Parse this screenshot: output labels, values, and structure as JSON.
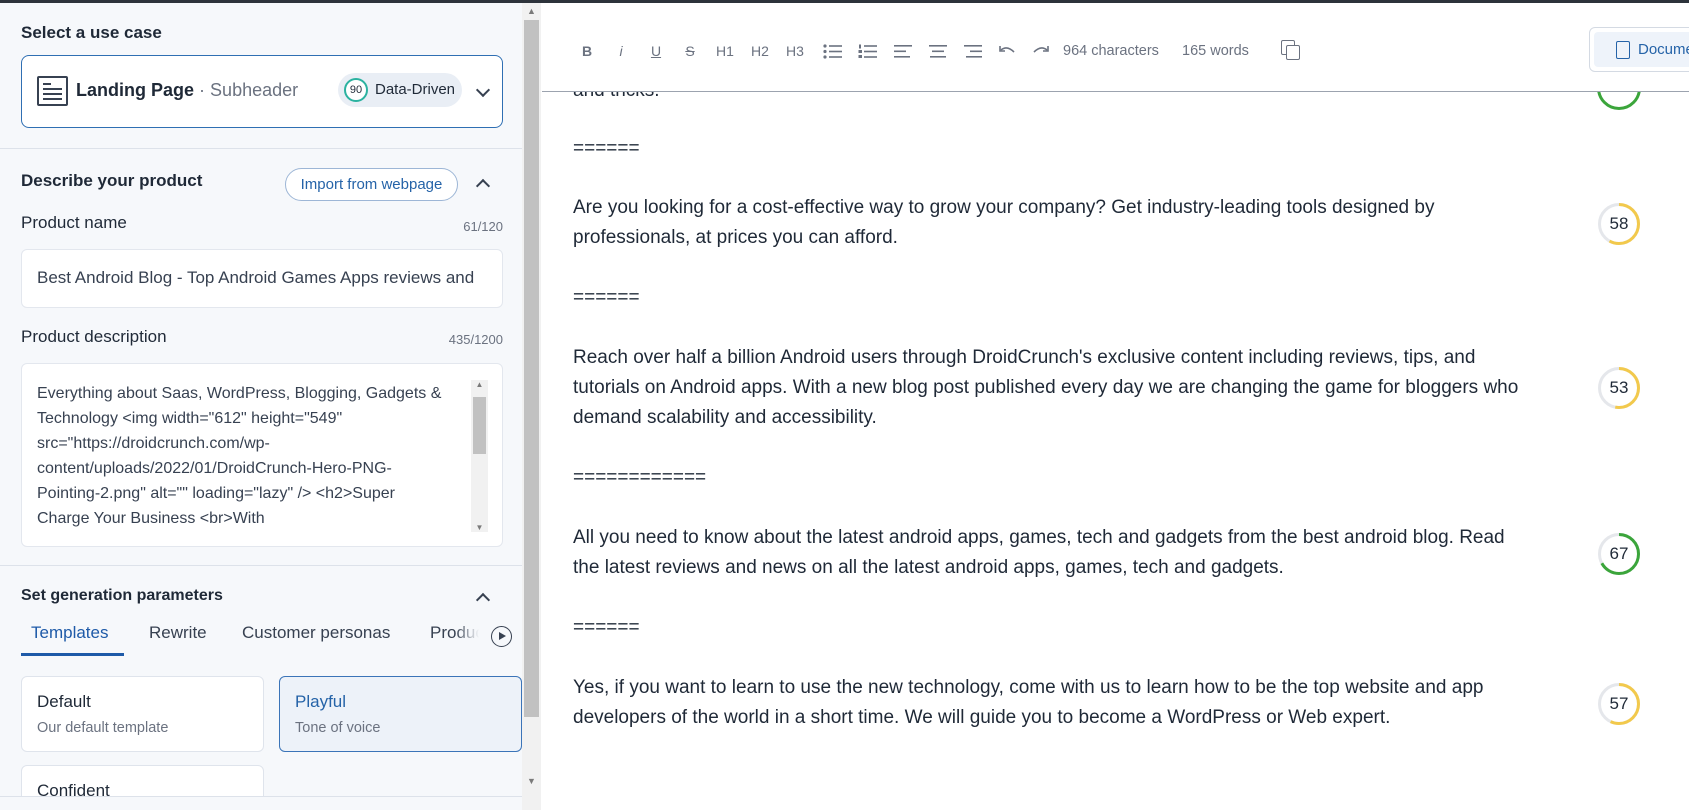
{
  "left": {
    "use_case_title": "Select a use case",
    "use_case": {
      "name": "Landing Page",
      "separator": "·",
      "sub": "Subheader",
      "badge_score": "90",
      "badge_label": "Data-Driven"
    },
    "describe_title": "Describe your product",
    "import_button": "Import from webpage",
    "product_name_label": "Product name",
    "product_name_count": "61/120",
    "product_name_value": "Best Android Blog - Top Android Games Apps reviews and",
    "product_description_label": "Product description",
    "product_description_count": "435/1200",
    "product_description_lines": [
      "Everything about Saas, WordPress, Blogging, Gadgets &",
      "Technology <img width=\"612\" height=\"549\"",
      "src=\"https://droidcrunch.com/wp-",
      "content/uploads/2022/01/DroidCrunch-Hero-PNG-",
      "Pointing-2.png\" alt=\"\" loading=\"lazy\" /> <h2>Super",
      "Charge Your Business <br>With"
    ],
    "params_title": "Set generation parameters",
    "tabs": [
      "Templates",
      "Rewrite",
      "Customer personas",
      "Produc"
    ],
    "templates": [
      {
        "title": "Default",
        "subtitle": "Our default template"
      },
      {
        "title": "Playful",
        "subtitle": "Tone of voice"
      },
      {
        "title": "Confident",
        "subtitle": ""
      }
    ]
  },
  "toolbar": {
    "bold": "B",
    "italic": "i",
    "underline": "U",
    "strike": "S",
    "h1": "H1",
    "h2": "H2",
    "h3": "H3",
    "characters": "964 characters",
    "words": "165 words",
    "document_button": "Docume"
  },
  "editor": {
    "cut_text": "and tricks.",
    "separators": [
      "======",
      "======",
      "============",
      "======"
    ],
    "blocks": [
      {
        "lines": [
          "Are you looking for a cost-effective way to grow your company? Get industry-leading tools designed by",
          "professionals, at prices you can afford."
        ],
        "score": 58,
        "score_color": "#f2c94c"
      },
      {
        "lines": [
          "Reach over half a billion Android users through DroidCrunch's exclusive content including reviews, tips, and",
          "tutorials on Android apps. With a new blog post published every day we are changing the game for bloggers who",
          "demand scalability and accessibility."
        ],
        "score": 53,
        "score_color": "#f2c94c"
      },
      {
        "lines": [
          "All you need to know about the latest android apps, games, tech and gadgets from the best android blog. Read",
          "the latest reviews and news on all the latest android apps, games, tech and gadgets."
        ],
        "score": 67,
        "score_color": "#3ba53b"
      },
      {
        "lines": [
          "Yes, if you want to learn to use the new technology, come with us to learn how to be the top website and app",
          "developers of the world in a short time. We will guide you to become a WordPress or Web expert."
        ],
        "score": 57,
        "score_color": "#f2c94c"
      }
    ]
  }
}
